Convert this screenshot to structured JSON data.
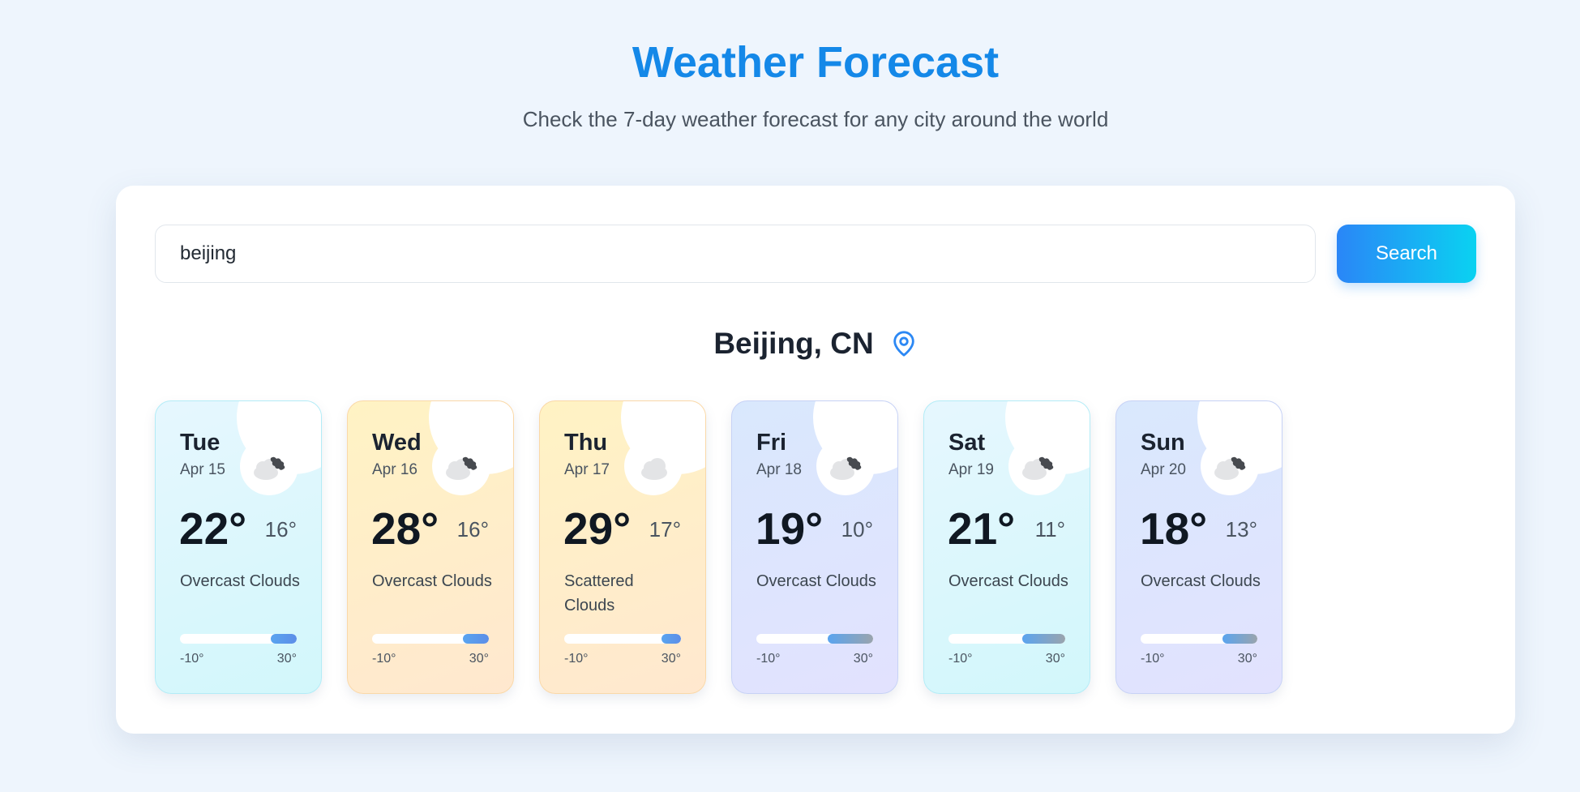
{
  "header": {
    "title": "Weather Forecast",
    "subtitle": "Check the 7-day weather forecast for any city around the world"
  },
  "search": {
    "value": "beijing",
    "button_label": "Search"
  },
  "location": {
    "name": "Beijing, CN",
    "icon": "map-pin-icon"
  },
  "colors": {
    "title": "#1488e8",
    "button_gradient_start": "#2a86f7",
    "button_gradient_end": "#0ad2f1",
    "pin": "#2c88f4"
  },
  "forecast": [
    {
      "day": "Tue",
      "date": "Apr 15",
      "high": "22°",
      "low": "16°",
      "description": "Overcast Clouds",
      "icon": "broken-clouds-icon",
      "theme": "cyan",
      "range_min": "-10°",
      "range_max": "30°",
      "range_fill": {
        "start": 0.78,
        "end": 1.0
      }
    },
    {
      "day": "Wed",
      "date": "Apr 16",
      "high": "28°",
      "low": "16°",
      "description": "Overcast Clouds",
      "icon": "broken-clouds-icon",
      "theme": "amber",
      "range_min": "-10°",
      "range_max": "30°",
      "range_fill": {
        "start": 0.78,
        "end": 1.0
      }
    },
    {
      "day": "Thu",
      "date": "Apr 17",
      "high": "29°",
      "low": "17°",
      "description": "Scattered Clouds",
      "icon": "cloud-icon",
      "theme": "amber",
      "range_min": "-10°",
      "range_max": "30°",
      "range_fill": {
        "start": 0.83,
        "end": 1.0
      }
    },
    {
      "day": "Fri",
      "date": "Apr 18",
      "high": "19°",
      "low": "10°",
      "description": "Overcast Clouds",
      "icon": "broken-clouds-icon",
      "theme": "indigo",
      "range_min": "-10°",
      "range_max": "30°",
      "range_fill": {
        "start": 0.61,
        "end": 1.0
      }
    },
    {
      "day": "Sat",
      "date": "Apr 19",
      "high": "21°",
      "low": "11°",
      "description": "Overcast Clouds",
      "icon": "broken-clouds-icon",
      "theme": "cyan",
      "range_min": "-10°",
      "range_max": "30°",
      "range_fill": {
        "start": 0.63,
        "end": 1.0
      }
    },
    {
      "day": "Sun",
      "date": "Apr 20",
      "high": "18°",
      "low": "13°",
      "description": "Overcast Clouds",
      "icon": "broken-clouds-icon",
      "theme": "indigo",
      "range_min": "-10°",
      "range_max": "30°",
      "range_fill": {
        "start": 0.7,
        "end": 1.0
      }
    }
  ]
}
